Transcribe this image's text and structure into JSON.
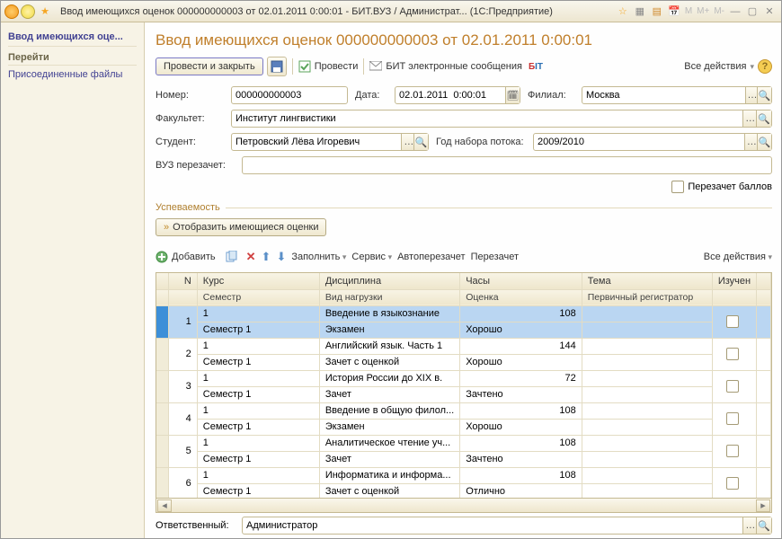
{
  "titlebar": {
    "title": "Ввод имеющихся оценок 000000000003 от 02.01.2011 0:00:01 - БИТ.ВУЗ / Администрат...   (1С:Предприятие)"
  },
  "sidebar": {
    "current": "Ввод имеющихся оце...",
    "group": "Перейти",
    "item1": "Присоединенные файлы"
  },
  "header": {
    "title": "Ввод имеющихся оценок 000000000003 от 02.01.2011 0:00:01"
  },
  "toolbar": {
    "post_close": "Провести и закрыть",
    "post": "Провести",
    "bit_msgs": "БИТ электронные сообщения",
    "all_actions": "Все действия"
  },
  "form": {
    "number_label": "Номер:",
    "number": "000000000003",
    "date_label": "Дата:",
    "date": "02.01.2011  0:00:01",
    "filial_label": "Филиал:",
    "filial": "Москва",
    "faculty_label": "Факультет:",
    "faculty": "Институт лингвистики",
    "student_label": "Студент:",
    "student": "Петровский Лёва Игоревич",
    "year_label": "Год набора потока:",
    "year": "2009/2010",
    "vuz_label": "ВУЗ перезачет:",
    "vuz": "",
    "rescore": "Перезачет баллов",
    "group_title": "Успеваемость",
    "show_grades": "Отобразить имеющиеся оценки"
  },
  "tabtools": {
    "add": "Добавить",
    "fill": "Заполнить",
    "service": "Сервис",
    "auto": "Автоперезачет",
    "re": "Перезачет",
    "all": "Все действия"
  },
  "thead": {
    "n": "N",
    "course": "Курс",
    "discipline": "Дисциплина",
    "hours": "Часы",
    "subject": "Тема",
    "studied": "Изучен",
    "semester": "Семестр",
    "load": "Вид нагрузки",
    "grade": "Оценка",
    "prim": "Первичный регистратор"
  },
  "rows": [
    {
      "n": "1",
      "course": "1",
      "sem": "Семестр 1",
      "disc": "Введение в языкознание",
      "load": "Экзамен",
      "hours": "108",
      "grade": "Хорошо"
    },
    {
      "n": "2",
      "course": "1",
      "sem": "Семестр 1",
      "disc": "Английский язык. Часть 1",
      "load": "Зачет с оценкой",
      "hours": "144",
      "grade": "Хорошо"
    },
    {
      "n": "3",
      "course": "1",
      "sem": "Семестр 1",
      "disc": "История России до XIX в.",
      "load": "Зачет",
      "hours": "72",
      "grade": "Зачтено"
    },
    {
      "n": "4",
      "course": "1",
      "sem": "Семестр 1",
      "disc": "Введение в общую филол...",
      "load": "Экзамен",
      "hours": "108",
      "grade": "Хорошо"
    },
    {
      "n": "5",
      "course": "1",
      "sem": "Семестр 1",
      "disc": "Аналитическое чтение уч...",
      "load": "Зачет",
      "hours": "108",
      "grade": "Зачтено"
    },
    {
      "n": "6",
      "course": "1",
      "sem": "Семестр 1",
      "disc": "Информатика и информа...",
      "load": "Зачет с оценкой",
      "hours": "108",
      "grade": "Отлично"
    }
  ],
  "footer": {
    "resp_label": "Ответственный:",
    "resp": "Администратор"
  }
}
